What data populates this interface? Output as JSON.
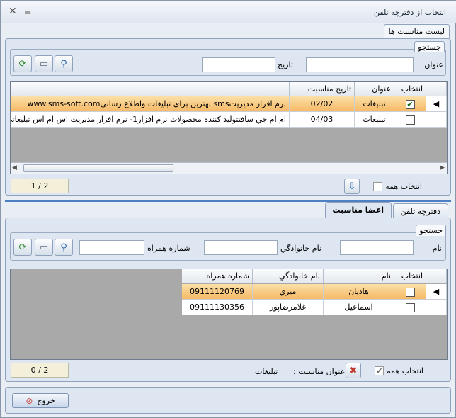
{
  "window": {
    "title": "انتخاب از دفترچه تلفن",
    "close_glyph": "✕",
    "min_glyph": "‗"
  },
  "occasions": {
    "panel_title": "ليست مناسبت ها",
    "search_title": "جستجو",
    "title_label": "عنوان",
    "title_value": "",
    "date_label": "تاريخ",
    "date_value": "",
    "columns": [
      "انتخاب",
      "عنوان",
      "تاريخ مناسبت",
      ""
    ],
    "rows": [
      {
        "checked": true,
        "title": "تبليغات",
        "date": "02/02",
        "text": "نرم افزار مديريتsms بهترين براي تبليغات واطلاع رسانيwww.sms-soft.com"
      },
      {
        "checked": false,
        "title": "تبليغات",
        "date": "04/03",
        "text": "ام ام جي سافتتوليد کننده محصولات نرم افزار1- نرم افزار مديريت اس ام اس تبليغاتي"
      }
    ],
    "select_all_label": "انتخاب همه",
    "counter": "1 / 2"
  },
  "tabs": [
    {
      "label": "دفترچه تلفن"
    },
    {
      "label": "اعضا مناسبت"
    }
  ],
  "members": {
    "search_title": "جستجو",
    "name_label": "نام",
    "name_value": "",
    "family_label": "نام خانوادگي",
    "family_value": "",
    "mobile_label": "شماره همراه",
    "mobile_value": "",
    "columns": [
      "انتخاب",
      "نام",
      "نام خانوادگي",
      "شماره همراه"
    ],
    "rows": [
      {
        "checked": false,
        "name": "هاديان",
        "family": "ميري",
        "mobile": "09111120769"
      },
      {
        "checked": false,
        "name": "اسماعيل",
        "family": "غلامرضاپور",
        "mobile": "09111130356"
      }
    ],
    "select_all_label": "انتخاب همه",
    "occasion_label": "عنوان مناسبت :",
    "occasion_value": "تبليغات",
    "counter": "0 / 2"
  },
  "exit_label": "خروج",
  "icons": {
    "refresh": "refresh-icon",
    "eraser": "eraser-icon",
    "search": "search-icon",
    "delete": "delete-icon",
    "exit": "exit-icon"
  },
  "colors": {
    "selected_row": "#f6b966",
    "grid_bg": "#a9a9a9",
    "panel_bg": "#dde6f1"
  }
}
